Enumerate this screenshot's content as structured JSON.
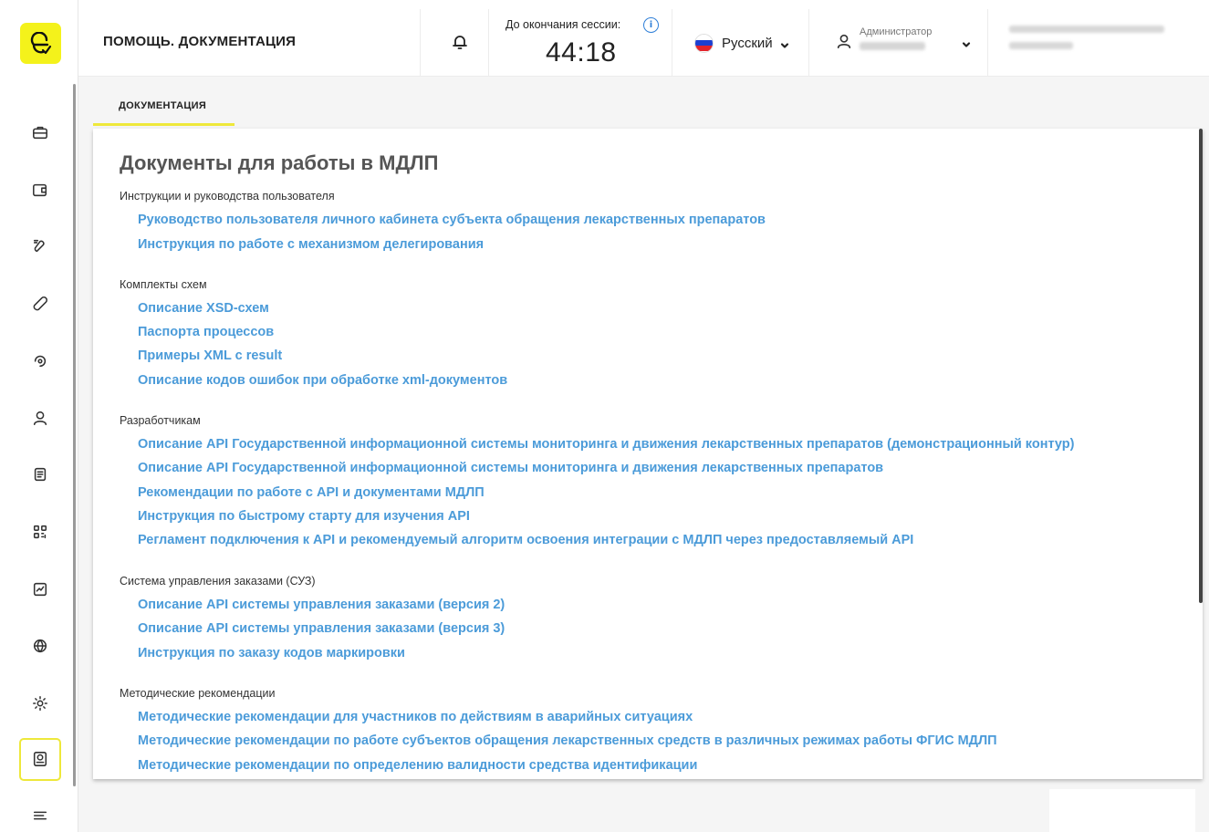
{
  "header": {
    "title": "ПОМОЩЬ. ДОКУМЕНТАЦИЯ",
    "session_label": "До окончания сессии:",
    "session_time": "44:18",
    "language": "Русский",
    "user_role": "Администратор"
  },
  "tabs": [
    {
      "label": "ДОКУМЕНТАЦИЯ",
      "active": true
    }
  ],
  "content": {
    "title": "Документы для работы в МДЛП",
    "sections": [
      {
        "title": "Инструкции и руководства пользователя",
        "links": [
          "Руководство пользователя личного кабинета субъекта обращения лекарственных препаратов",
          "Инструкция по работе с механизмом делегирования"
        ]
      },
      {
        "title": "Комплекты схем",
        "links": [
          "Описание XSD-схем",
          "Паспорта процессов",
          "Примеры XML с result",
          "Описание кодов ошибок при обработке xml-документов"
        ]
      },
      {
        "title": "Разработчикам",
        "links": [
          "Описание API Государственной информационной системы мониторинга и движения лекарственных препаратов (демонстрационный контур)",
          "Описание API Государственной информационной системы мониторинга и движения лекарственных препаратов",
          "Рекомендации по работе с API и документами МДЛП",
          "Инструкция по быстрому старту для изучения API",
          "Регламент подключения к API и рекомендуемый алгоритм освоения интеграции с МДЛП через предоставляемый API"
        ]
      },
      {
        "title": "Система управления заказами (СУЗ)",
        "links": [
          "Описание API системы управления заказами (версия 2)",
          "Описание API системы управления заказами (версия 3)",
          "Инструкция по заказу кодов маркировки"
        ]
      },
      {
        "title": "Методические рекомендации",
        "links": [
          "Методические рекомендации для участников по действиям в аварийных ситуациях",
          "Методические рекомендации по работе субъектов обращения лекарственных средств в различных режимах работы ФГИС МДЛП",
          "Методические рекомендации по определению валидности средства идентификации"
        ]
      }
    ]
  },
  "sidebar": {
    "icons": [
      "briefcase-icon",
      "wallet-icon",
      "pills-icon",
      "capsule-icon",
      "circular-arrow-icon",
      "user-icon",
      "document-list-icon",
      "qr-code-icon",
      "chart-icon",
      "globe-icon",
      "settings-icon",
      "help-book-icon",
      "menu-icon"
    ]
  },
  "colors": {
    "accent": "#f4f21b",
    "link": "#4b9bd9"
  }
}
